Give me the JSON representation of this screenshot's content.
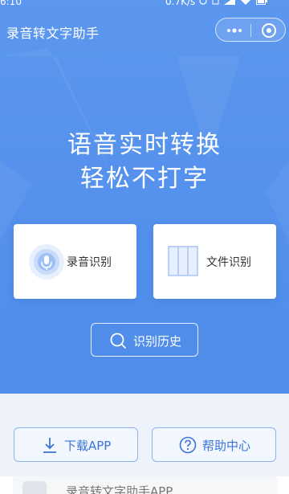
{
  "status_bar": {
    "time": "6:10",
    "speed": "0.7K/s",
    "icons": [
      "alarm-icon",
      "sim-icon",
      "signal-icon",
      "wifi-icon",
      "battery-icon"
    ]
  },
  "header": {
    "title": "录音转文字助手",
    "menu_icon": "more-icon",
    "close_icon": "target-icon"
  },
  "hero": {
    "headline_line1": "语音实时转换",
    "headline_line2": "轻松不打字"
  },
  "cards": {
    "record": {
      "label": "录音识别",
      "icon": "microphone-icon"
    },
    "file": {
      "label": "文件识别",
      "icon": "document-icon"
    }
  },
  "history_button": {
    "label": "识别历史",
    "icon": "search-icon"
  },
  "bottom_buttons": {
    "download": {
      "label": "下载APP",
      "icon": "download-icon"
    },
    "help": {
      "label": "帮助中心",
      "icon": "question-icon"
    }
  },
  "promo": {
    "text": "录音转文字助手APP"
  },
  "colors": {
    "hero_blue": "#5291ed",
    "accent_blue": "#3b74d8",
    "card_bg": "#ffffff"
  }
}
